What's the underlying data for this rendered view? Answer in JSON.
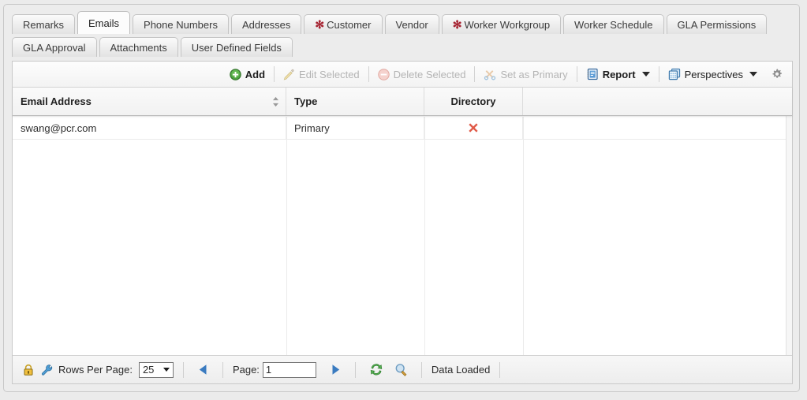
{
  "tabs": {
    "row1": [
      {
        "label": "Remarks",
        "active": false,
        "required": false
      },
      {
        "label": "Emails",
        "active": true,
        "required": false
      },
      {
        "label": "Phone Numbers",
        "active": false,
        "required": false
      },
      {
        "label": "Addresses",
        "active": false,
        "required": false
      },
      {
        "label": "Customer",
        "active": false,
        "required": true
      },
      {
        "label": "Vendor",
        "active": false,
        "required": false
      },
      {
        "label": "Worker Workgroup",
        "active": false,
        "required": true
      },
      {
        "label": "Worker Schedule",
        "active": false,
        "required": false
      },
      {
        "label": "GLA Permissions",
        "active": false,
        "required": false
      }
    ],
    "row2": [
      {
        "label": "GLA Approval",
        "active": false,
        "required": false
      },
      {
        "label": "Attachments",
        "active": false,
        "required": false
      },
      {
        "label": "User Defined Fields",
        "active": false,
        "required": false
      }
    ],
    "required_marker": "✻"
  },
  "toolbar": {
    "add_label": "Add",
    "edit_label": "Edit Selected",
    "delete_label": "Delete Selected",
    "set_primary_label": "Set as Primary",
    "report_label": "Report",
    "perspectives_label": "Perspectives"
  },
  "grid": {
    "columns": [
      {
        "label": "Email Address",
        "sortable": true
      },
      {
        "label": "Type",
        "sortable": false
      },
      {
        "label": "Directory",
        "sortable": false
      },
      {
        "label": "",
        "sortable": false
      }
    ],
    "rows": [
      {
        "email": "swang@pcr.com",
        "type": "Primary",
        "directory": "✖",
        "extra": ""
      }
    ]
  },
  "footer": {
    "rows_per_page_label": "Rows Per Page:",
    "rows_per_page_value": "25",
    "page_label": "Page:",
    "page_value": "1",
    "status": "Data Loaded"
  },
  "colors": {
    "required_marker": "#a52230",
    "directory_x": "#e05a48",
    "add_icon": "#4ba03f",
    "accent_blue": "#2f6fb5"
  }
}
